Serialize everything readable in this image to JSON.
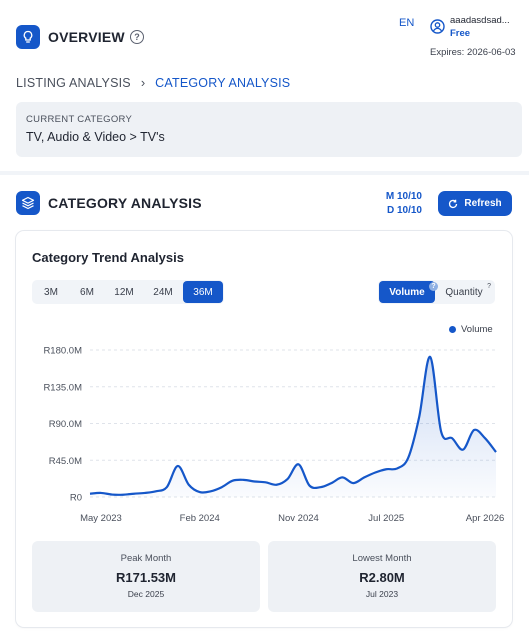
{
  "header": {
    "title": "OVERVIEW",
    "language": "EN",
    "user": {
      "name": "aaadasdsad...",
      "plan": "Free",
      "expires": "Expires: 2026-06-03"
    }
  },
  "breadcrumb": {
    "items": [
      "LISTING ANALYSIS",
      "CATEGORY ANALYSIS"
    ]
  },
  "current_category": {
    "label": "CURRENT CATEGORY",
    "value": "TV, Audio & Video > TV's"
  },
  "section": {
    "title": "CATEGORY ANALYSIS",
    "month_quota": "M 10/10",
    "day_quota": "D 10/10",
    "refresh_label": "Refresh"
  },
  "trend": {
    "title": "Category Trend Analysis",
    "periods": [
      "3M",
      "6M",
      "12M",
      "24M",
      "36M"
    ],
    "active_period": "36M",
    "metrics": [
      "Volume",
      "Quantity"
    ],
    "active_metric": "Volume",
    "accent": "#1557c9"
  },
  "chart_data": {
    "type": "area",
    "legend": [
      "Volume"
    ],
    "legend_position": "top-right",
    "y_tick_labels": [
      "R0",
      "R45.0M",
      "R90.0M",
      "R135.0M",
      "R180.0M"
    ],
    "y_ticks": [
      0,
      45,
      90,
      135,
      180
    ],
    "ylim": [
      0,
      180
    ],
    "x_tick_labels": [
      "May 2023",
      "Feb 2024",
      "Nov 2024",
      "Jul 2025",
      "Apr 2026"
    ],
    "x_tick_index": [
      1,
      10,
      19,
      27,
      36
    ],
    "grid": true,
    "series": [
      {
        "name": "Volume",
        "x": [
          "Apr 2023",
          "May 2023",
          "Jun 2023",
          "Jul 2023",
          "Aug 2023",
          "Sep 2023",
          "Oct 2023",
          "Nov 2023",
          "Dec 2023",
          "Jan 2024",
          "Feb 2024",
          "Mar 2024",
          "Apr 2024",
          "May 2024",
          "Jun 2024",
          "Jul 2024",
          "Aug 2024",
          "Sep 2024",
          "Oct 2024",
          "Nov 2024",
          "Dec 2024",
          "Jan 2025",
          "Feb 2025",
          "Mar 2025",
          "Apr 2025",
          "May 2025",
          "Jun 2025",
          "Jul 2025",
          "Aug 2025",
          "Sep 2025",
          "Oct 2025",
          "Nov 2025",
          "Dec 2025",
          "Jan 2026",
          "Feb 2026",
          "Mar 2026",
          "Apr 2026",
          "May 2026"
        ],
        "values": [
          4,
          5,
          3,
          2.8,
          4,
          5,
          7,
          12,
          38,
          15,
          6,
          7,
          12,
          20,
          21,
          19,
          18,
          15,
          22,
          40,
          14,
          12,
          17,
          24,
          17,
          24,
          30,
          34,
          35,
          48,
          98,
          171.53,
          80,
          72,
          58,
          82,
          72,
          55
        ]
      }
    ]
  },
  "stats": {
    "peak": {
      "label": "Peak Month",
      "value": "R171.53M",
      "date": "Dec 2025"
    },
    "lowest": {
      "label": "Lowest Month",
      "value": "R2.80M",
      "date": "Jul 2023"
    }
  }
}
